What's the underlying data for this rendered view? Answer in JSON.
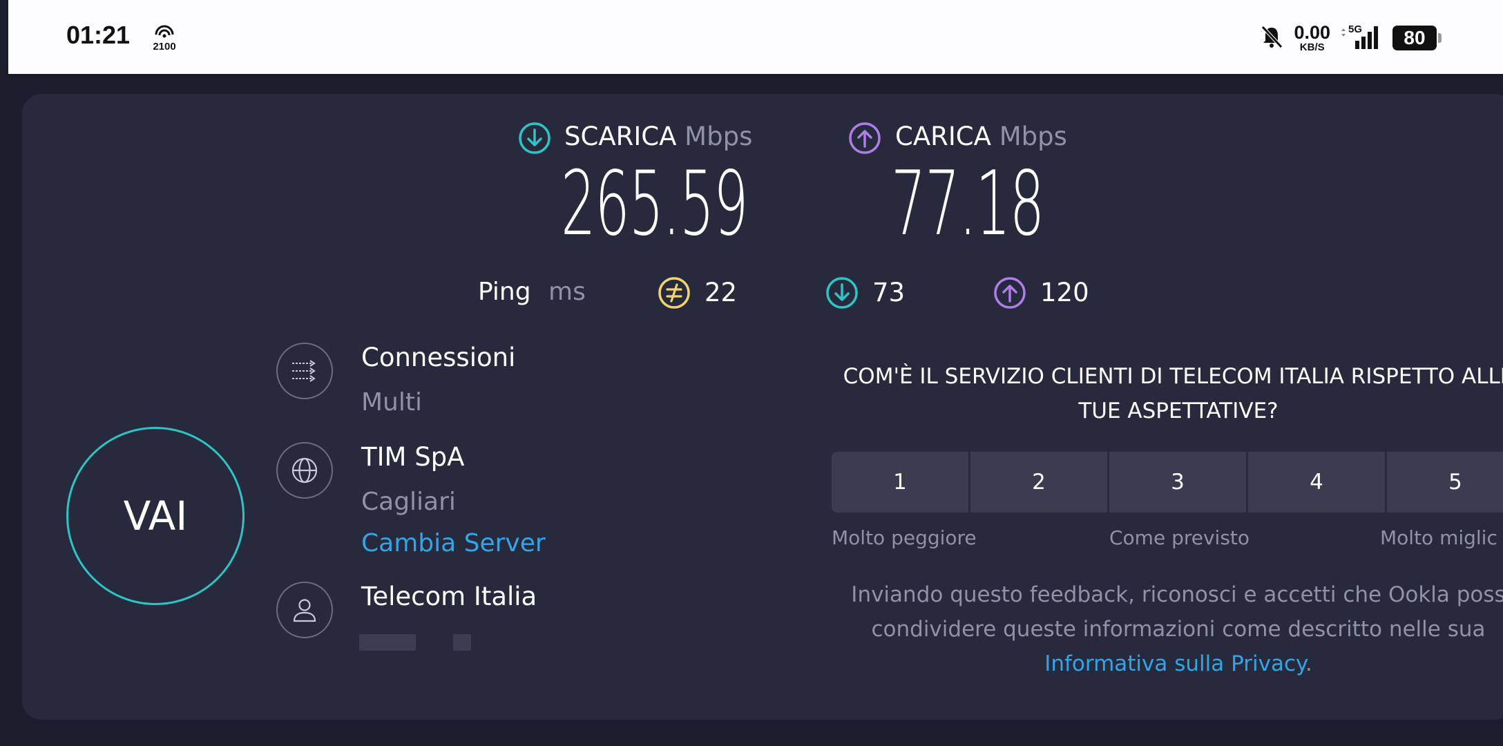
{
  "status_bar": {
    "time": "01:21",
    "hotspot_label": "2100",
    "net_speed_value": "0.00",
    "net_speed_unit": "KB/S",
    "network": "5G",
    "battery": "80"
  },
  "results": {
    "download": {
      "label": "SCARICA",
      "unit": "Mbps",
      "value": "265.59",
      "color": "#2ec4c6"
    },
    "upload": {
      "label": "CARICA",
      "unit": "Mbps",
      "value": "77.18",
      "color": "#b07ce8"
    },
    "ping": {
      "label": "Ping",
      "unit": "ms",
      "idle": "22",
      "download": "73",
      "upload": "120",
      "idle_color": "#f2d46a"
    }
  },
  "go_button": {
    "label": "VAI"
  },
  "info": {
    "connections": {
      "title": "Connessioni",
      "value": "Multi"
    },
    "server": {
      "title": "TIM SpA",
      "location": "Cagliari",
      "change_link": "Cambia Server"
    },
    "provider": {
      "title": "Telecom Italia"
    }
  },
  "survey": {
    "question": "COM'È IL SERVIZIO CLIENTI DI TELECOM ITALIA RISPETTO ALLE TUE ASPETTATIVE?",
    "options": [
      "1",
      "2",
      "3",
      "4",
      "5"
    ],
    "label_low": "Molto peggiore",
    "label_mid": "Come previsto",
    "label_high": "Molto miglic",
    "disclaimer": "Inviando questo feedback, riconosci e accetti che Ookla poss condividere queste informazioni come descritto nelle sua",
    "privacy_link": "Informativa sulla Privacy",
    "privacy_suffix": "."
  },
  "colors": {
    "accent_link": "#33a5e6",
    "card_bg": "#272a3d",
    "page_bg": "#1b1d2c"
  }
}
